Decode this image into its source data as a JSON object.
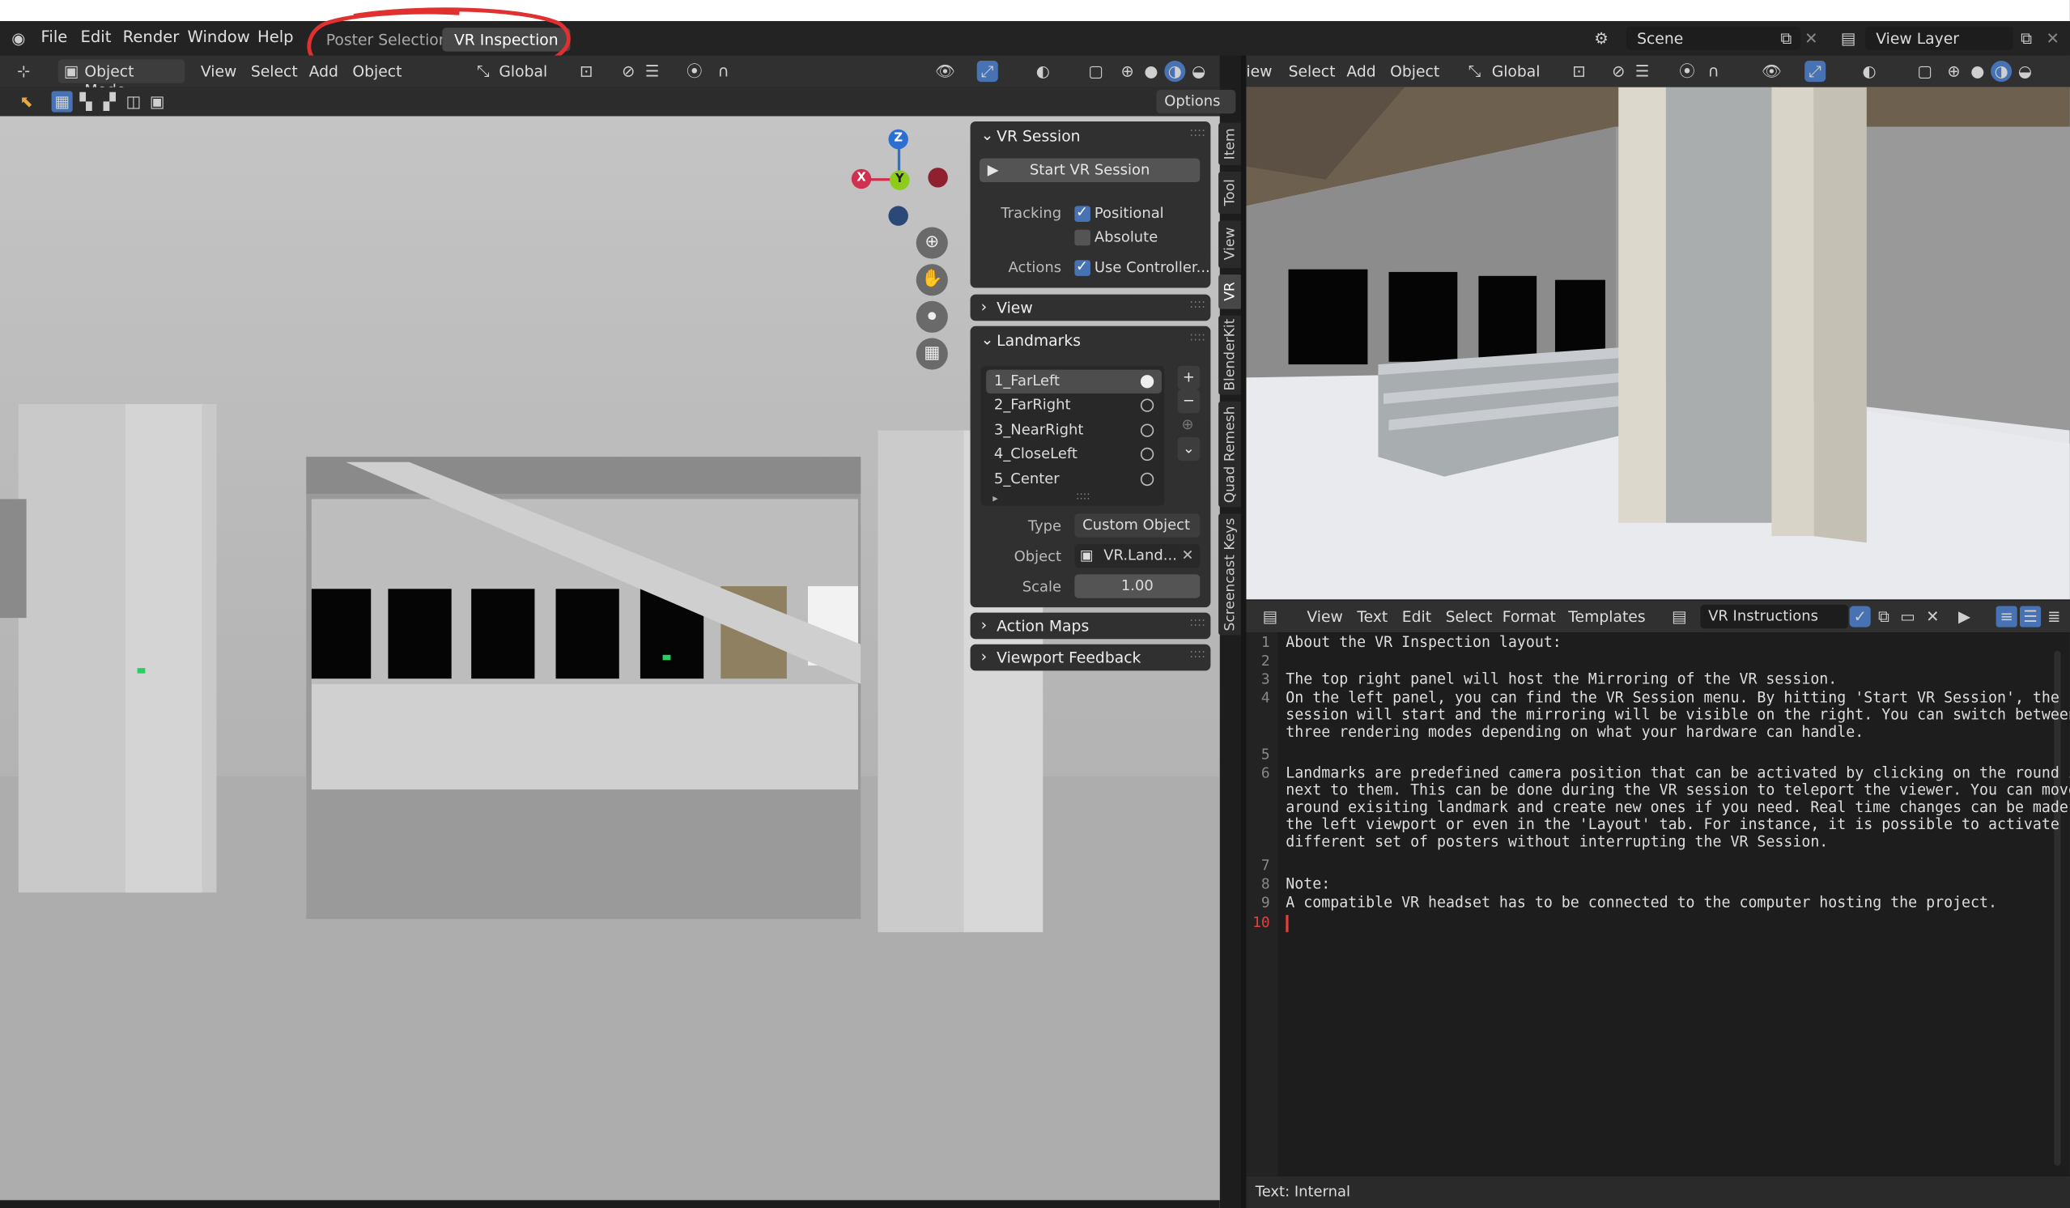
{
  "menubar": {
    "items": [
      "File",
      "Edit",
      "Render",
      "Window",
      "Help"
    ],
    "tabs": [
      "Poster Selection",
      "VR Inspection"
    ],
    "scene": "Scene",
    "view_layer": "View Layer"
  },
  "left_header": {
    "mode": "Object Mode",
    "menus": [
      "View",
      "Select",
      "Add",
      "Object"
    ],
    "orientation": "Global",
    "options": "Options"
  },
  "gizmo": {
    "z": "Z",
    "x": "X",
    "y": "Y"
  },
  "vr_panel": {
    "title": "VR Session",
    "start_button": "Start VR Session",
    "tracking_label": "Tracking",
    "positional": "Positional",
    "absolute": "Absolute",
    "actions_label": "Actions",
    "use_controller": "Use Controller...",
    "view_title": "View",
    "landmarks_title": "Landmarks",
    "landmarks": [
      {
        "name": "1_FarLeft",
        "active": true
      },
      {
        "name": "2_FarRight",
        "active": false
      },
      {
        "name": "3_NearRight",
        "active": false
      },
      {
        "name": "4_CloseLeft",
        "active": false
      },
      {
        "name": "5_Center",
        "active": false
      }
    ],
    "type_label": "Type",
    "type_value": "Custom Object",
    "object_label": "Object",
    "object_value": "VR.Land...",
    "scale_label": "Scale",
    "scale_value": "1.00",
    "action_maps": "Action Maps",
    "viewport_feedback": "Viewport Feedback"
  },
  "side_tabs": [
    "Item",
    "Tool",
    "View",
    "VR",
    "BlenderKit",
    "Quad Remesh",
    "Screencast Keys"
  ],
  "right_header": {
    "menus": [
      "iew",
      "Select",
      "Add",
      "Object"
    ],
    "orientation": "Global"
  },
  "text_editor": {
    "menus": [
      "View",
      "Text",
      "Edit",
      "Select",
      "Format",
      "Templates"
    ],
    "file_name": "VR Instructions",
    "status": "Text: Internal",
    "lines": [
      "About the VR Inspection layout:",
      "",
      "The top right panel will host the Mirroring of the VR session.",
      "On the left panel, you can find the VR Session menu. By hitting 'Start VR Session', the\nsession will start and the mirroring will be visible on the right. You can switch between\nthree rendering modes depending on what your hardware can handle.",
      "",
      "Landmarks are predefined camera position that can be activated by clicking on the round icon\nnext to them. This can be done during the VR session to teleport the viewer. You can move\naround exisiting landmark and create new ones if you need. Real time changes can be made in\nthe left viewport or even in the 'Layout' tab. For instance, it is possible to activate\ndifferent set of posters without interrupting the VR Session.",
      "",
      "Note:",
      "A compatible VR headset has to be connected to the computer hosting the project.",
      ""
    ],
    "line_numbers": [
      "1",
      "2",
      "3",
      "4",
      "5",
      "6",
      "7",
      "8",
      "9",
      "10"
    ]
  },
  "colors": {
    "accent": "#4772b3",
    "annotation": "#e03030"
  }
}
